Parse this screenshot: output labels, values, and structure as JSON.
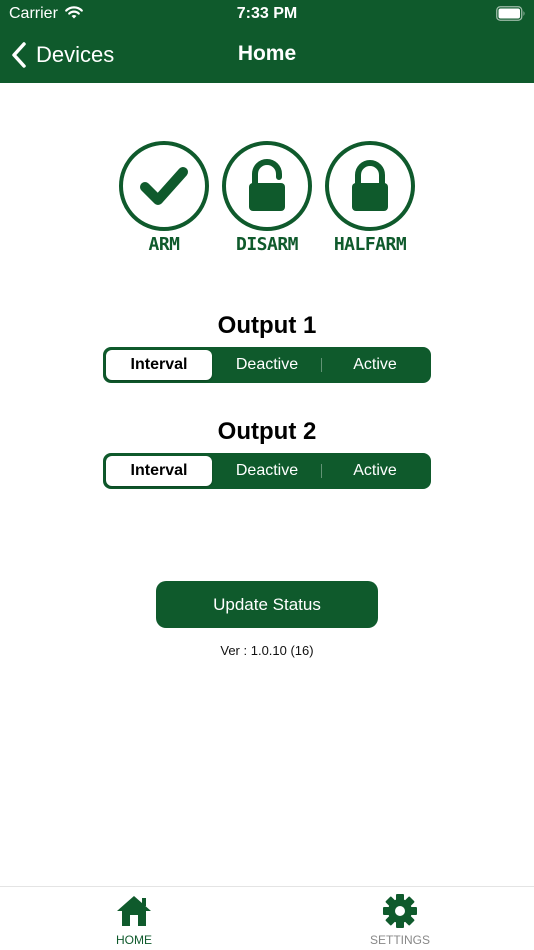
{
  "status_bar": {
    "carrier": "Carrier",
    "time": "7:33 PM"
  },
  "nav": {
    "back_label": "Devices",
    "title": "Home"
  },
  "modes": [
    {
      "label": "ARM",
      "icon": "check-icon"
    },
    {
      "label": "DISARM",
      "icon": "unlocked-padlock-icon"
    },
    {
      "label": "HALFARM",
      "icon": "locked-padlock-icon"
    }
  ],
  "outputs": [
    {
      "title": "Output 1",
      "segments": [
        "Interval",
        "Deactive",
        "Active"
      ],
      "selected": "Interval"
    },
    {
      "title": "Output 2",
      "segments": [
        "Interval",
        "Deactive",
        "Active"
      ],
      "selected": "Interval"
    }
  ],
  "update_button": "Update Status",
  "version": "Ver : 1.0.10 (16)",
  "tabs": [
    {
      "label": "HOME",
      "icon": "home-icon",
      "active": true
    },
    {
      "label": "SETTINGS",
      "icon": "gear-icon",
      "active": false
    }
  ],
  "colors": {
    "brand_green": "#0f5a2c",
    "tab_inactive": "#888888"
  }
}
